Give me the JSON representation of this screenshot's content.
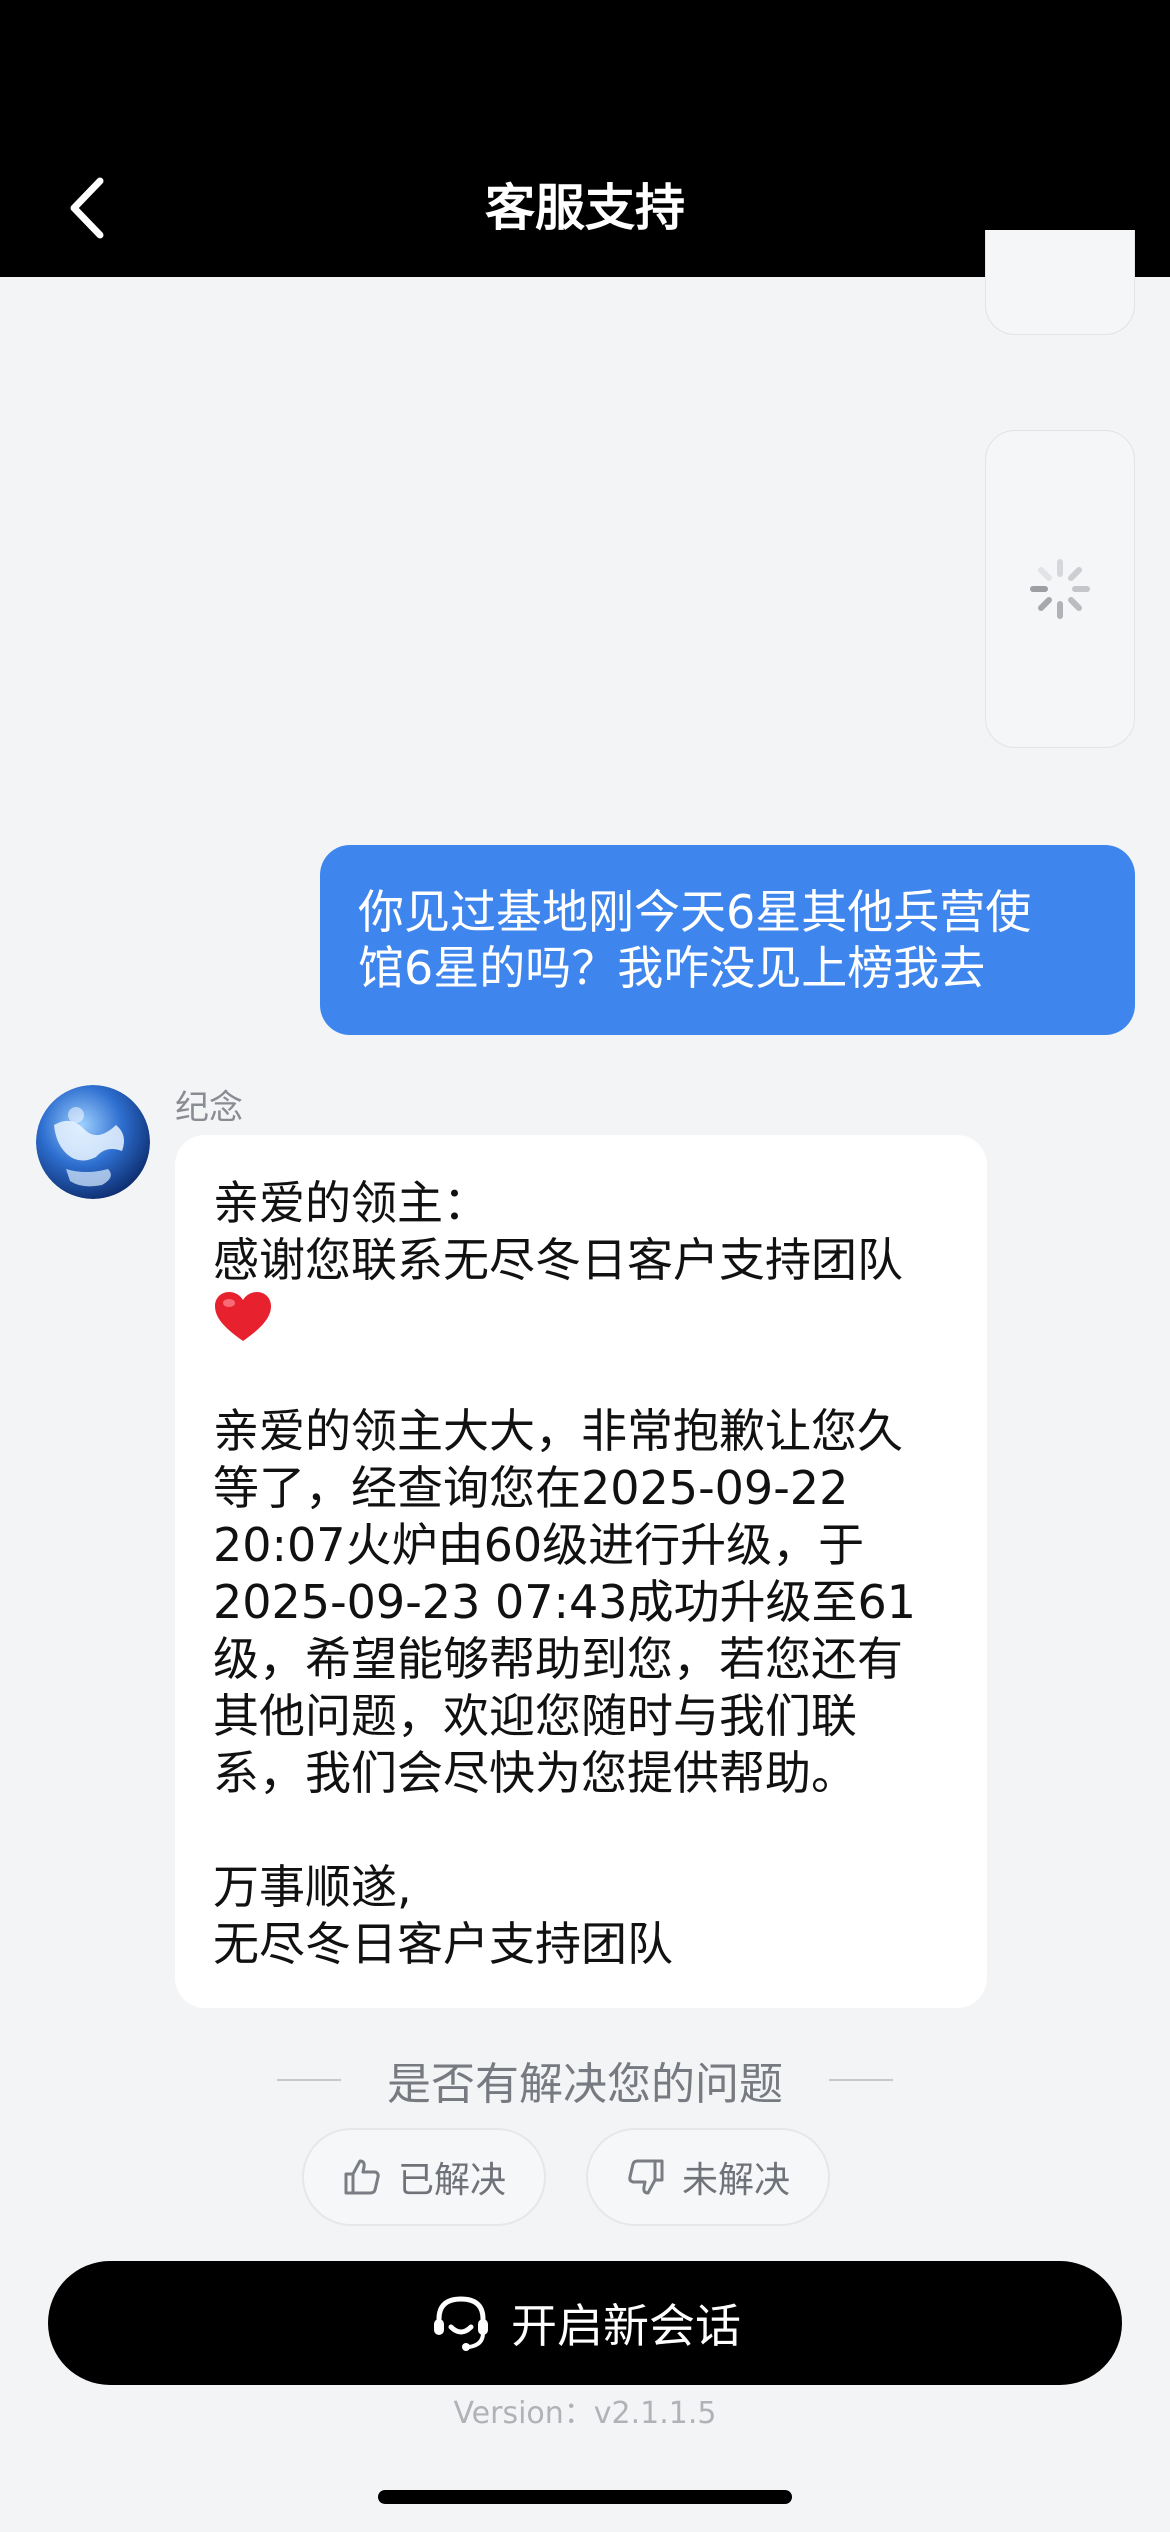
{
  "header": {
    "title": "客服支持",
    "back_icon": "chevron-left-icon"
  },
  "conversation": {
    "user_message": {
      "lines": [
        "你见过基地刚今天6星其他兵营使",
        "馆6星的吗？我咋没见上榜我去"
      ]
    },
    "agent": {
      "name": "纪念",
      "message": {
        "line1": "亲爱的领主：",
        "line2": "感谢您联系无尽冬日客户支持团队",
        "heart": "❤️",
        "para2": [
          "亲爱的领主大大，非常抱歉让您久",
          "等了，经查询您在2025-09-22",
          "20:07火炉由60级进行升级，于",
          "2025-09-23 07:43成功升级至61",
          "级，希望能够帮助到您，若您还有",
          "其他问题，欢迎您随时与我们联",
          "系，我们会尽快为您提供帮助。"
        ],
        "signoff1": "万事顺遂,",
        "signoff2": "无尽冬日客户支持团队"
      }
    }
  },
  "feedback": {
    "question": "是否有解决您的问题",
    "resolved_label": "已解决",
    "unresolved_label": "未解决",
    "resolved_icon": "thumbs-up-icon",
    "unresolved_icon": "thumbs-down-icon"
  },
  "footer": {
    "new_chat_label": "开启新会话",
    "new_chat_icon": "headset-icon",
    "version": "Version：v2.1.1.5"
  },
  "colors": {
    "header_bg": "#000000",
    "user_bubble": "#3f85ee",
    "page_bg": "#f3f4f6"
  }
}
